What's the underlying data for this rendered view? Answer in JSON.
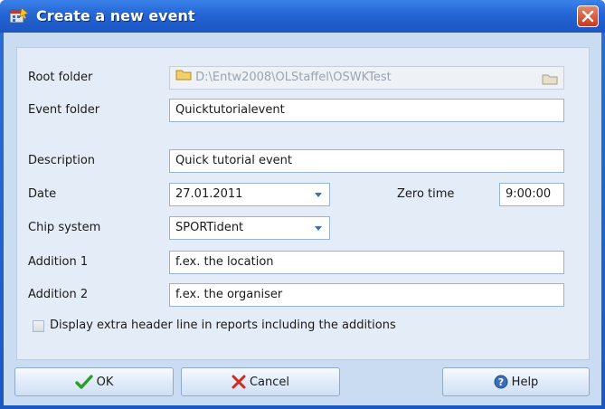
{
  "window": {
    "title": "Create a new event",
    "title_bar_color": "#2464d3",
    "close_icon": "close-icon"
  },
  "form": {
    "root_folder": {
      "label": "Root folder",
      "value": "D:\\Entw2008\\OLStaffel\\OSWKTest"
    },
    "event_folder": {
      "label": "Event folder",
      "value": "Quicktutorialevent"
    },
    "description": {
      "label": "Description",
      "value": "Quick tutorial event"
    },
    "date": {
      "label": "Date",
      "value": "27.01.2011"
    },
    "zero_time": {
      "label": "Zero time",
      "value": "9:00:00"
    },
    "chip_system": {
      "label": "Chip system",
      "value": "SPORTident"
    },
    "addition1": {
      "label": "Addition 1",
      "value": "f.ex. the location"
    },
    "addition2": {
      "label": "Addition 2",
      "value": "f.ex. the organiser"
    },
    "extra_header": {
      "label": "Display extra header line in reports including the additions",
      "checked": false
    }
  },
  "buttons": {
    "ok": "OK",
    "cancel": "Cancel",
    "help": "Help"
  }
}
